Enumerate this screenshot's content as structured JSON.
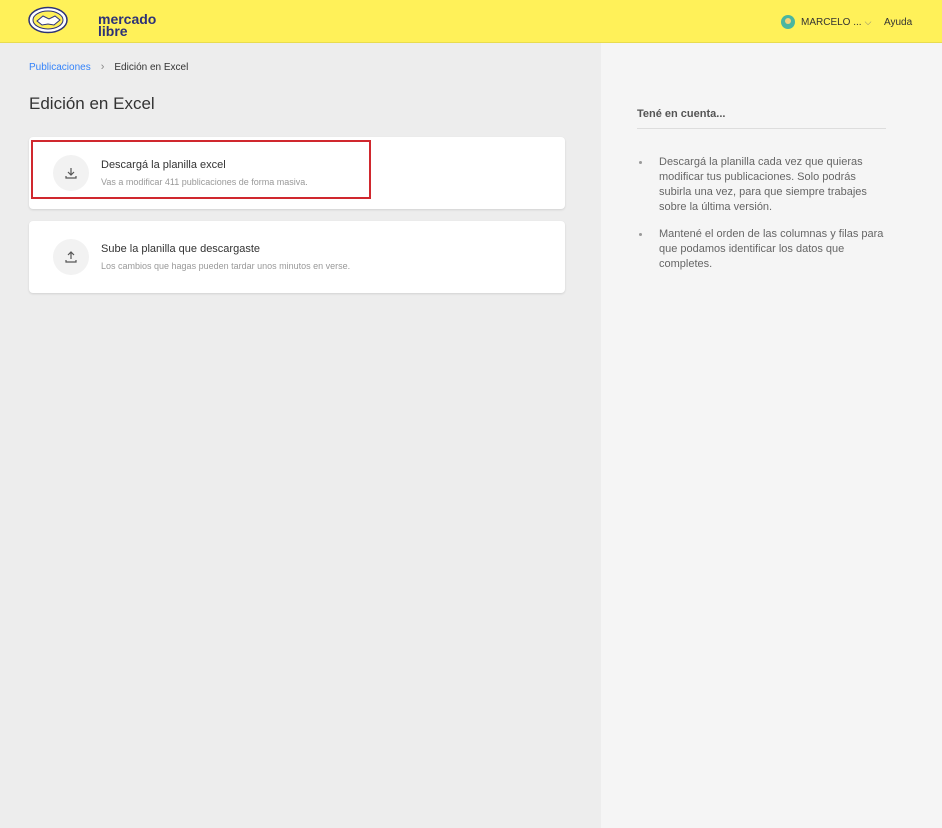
{
  "header": {
    "logo_text_line1": "mercado",
    "logo_text_line2": "libre",
    "user_name": "MARCELO ...",
    "help_label": "Ayuda"
  },
  "breadcrumb": {
    "link": "Publicaciones",
    "current": "Edición en Excel"
  },
  "page_title": "Edición en Excel",
  "cards": [
    {
      "icon": "download-icon",
      "title": "Descargá la planilla excel",
      "subtitle": "Vas a modificar 411 publicaciones de forma masiva."
    },
    {
      "icon": "upload-icon",
      "title": "Sube la planilla que descargaste",
      "subtitle": "Los cambios que hagas pueden tardar unos minutos en verse."
    }
  ],
  "sidebar": {
    "title": "Tené en cuenta...",
    "tips": [
      "Descargá la planilla cada vez que quieras modificar tus publicaciones. Solo podrás subirla una vez, para que siempre trabajes sobre la última versión.",
      "Mantené el orden de las columnas y filas para que podamos identificar los datos que completes."
    ]
  },
  "colors": {
    "header_bg": "#fff159",
    "link": "#3483fa",
    "highlight": "#d0282e",
    "brand_text": "#2d3277"
  }
}
